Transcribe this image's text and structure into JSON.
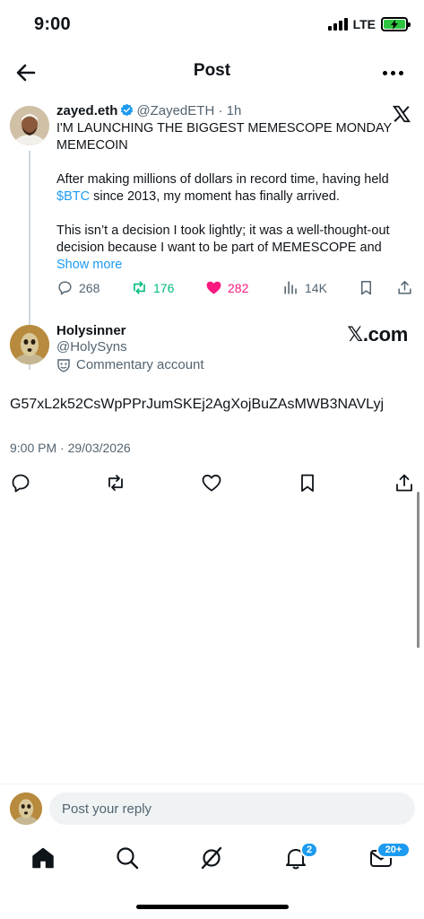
{
  "status_bar": {
    "time": "9:00",
    "network": "LTE"
  },
  "header": {
    "title": "Post"
  },
  "quoted_post": {
    "name": "zayed.eth",
    "handle": "@ZayedETH",
    "time": "· 1h",
    "text_line1": "I'M LAUNCHING THE BIGGEST MEMESCOPE MONDAY MEMECOIN",
    "text_p2_before": "After making millions of dollars in record time, having held ",
    "text_p2_link": "$BTC",
    "text_p2_after": " since 2013, my moment has finally arrived.",
    "text_p3": "This isn’t a decision I took lightly; it was a well-thought-out decision because I want to be part of MEMESCOPE and ",
    "show_more": "Show more",
    "stats": {
      "replies": "268",
      "reposts": "176",
      "likes": "282",
      "views": "14K"
    },
    "colors": {
      "repost": "#00ba7c",
      "like": "#f91880",
      "link": "#1d9bf0"
    }
  },
  "main_post": {
    "name": "Holysinner",
    "handle": "@HolySyns",
    "label": "Commentary account",
    "source": "𝕏.com",
    "text": "G57xL2k52CsWpPPrJumSKEj2AgXojBuZAsMWB3NAVLyj",
    "timestamp": "9:00 PM · 29/03/2026"
  },
  "reply": {
    "placeholder": "Post your reply"
  },
  "nav": {
    "items": [
      "home",
      "search",
      "grok",
      "notifications",
      "messages"
    ],
    "notifications_badge": "2",
    "messages_badge": "20+"
  }
}
